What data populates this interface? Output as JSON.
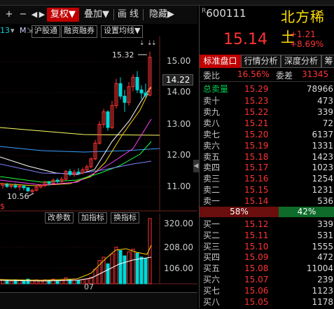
{
  "toolbar": {
    "plus_icon": "+",
    "minus_icon": "−",
    "left_icon": "◀",
    "right_icon": "▶",
    "fuquan": "复权▼",
    "diejia": "叠加▼",
    "huaxian": "画 线",
    "yincang": "隐藏▶"
  },
  "chart_tools": {
    "num": "13",
    "m_label": "M",
    "hgt": "沪股通",
    "rzrq": "融资融券",
    "set_ma": "设置均线▼"
  },
  "chart_labels": {
    "high_price": "15.32",
    "low_price": "10.56",
    "date_label": "07",
    "icon_s": "$"
  },
  "price_axis": [
    "15.00",
    "14.22",
    "14.00",
    "13.00",
    "12.00",
    "11.00"
  ],
  "volume_axis": [
    "320.00",
    "208.00",
    "106.00"
  ],
  "indicator_toolbar": {
    "gai_canshu": "改参数",
    "jia_zhibiao": "加指标",
    "huan_zhibiao": "换指标"
  },
  "stock": {
    "code": "600111",
    "code_prefix": "R",
    "name": "北方稀土",
    "price": "15.14",
    "change": "+1.21",
    "change_pct": "+8.69%"
  },
  "tabs": [
    "标准盘口",
    "行情分析",
    "深度分析",
    "筹"
  ],
  "weibi": {
    "label": "委比",
    "value": "16.56%",
    "label2": "委差",
    "value2": "31345"
  },
  "sell_total": {
    "label": "总卖量",
    "price": "15.29",
    "volume": "78966"
  },
  "sell_orders": [
    {
      "label": "卖十",
      "price": "15.23",
      "volume": "473"
    },
    {
      "label": "卖九",
      "price": "15.22",
      "volume": "339"
    },
    {
      "label": "卖八",
      "price": "15.21",
      "volume": "72"
    },
    {
      "label": "卖七",
      "price": "15.20",
      "volume": "6137"
    },
    {
      "label": "卖六",
      "price": "15.19",
      "volume": "1331"
    },
    {
      "label": "卖五",
      "price": "15.18",
      "volume": "1423"
    },
    {
      "label": "卖四",
      "price": "15.17",
      "volume": "1023"
    },
    {
      "label": "卖三",
      "price": "15.16",
      "volume": "1254"
    },
    {
      "label": "卖二",
      "price": "15.15",
      "volume": "1231"
    },
    {
      "label": "卖一",
      "price": "15.14",
      "volume": "536"
    }
  ],
  "ratio": {
    "sell": "58%",
    "buy": "42%"
  },
  "buy_orders": [
    {
      "label": "买一",
      "price": "15.12",
      "volume": "339"
    },
    {
      "label": "买二",
      "price": "15.11",
      "volume": "531"
    },
    {
      "label": "买三",
      "price": "15.10",
      "volume": "1555"
    },
    {
      "label": "买四",
      "price": "15.09",
      "volume": "472"
    },
    {
      "label": "买五",
      "price": "15.08",
      "volume": "11004"
    },
    {
      "label": "买六",
      "price": "15.07",
      "volume": "239"
    },
    {
      "label": "买七",
      "price": "15.06",
      "volume": "1123"
    },
    {
      "label": "买八",
      "price": "15.05",
      "volume": "1178"
    }
  ],
  "colors": {
    "up": "#ff3333",
    "down": "#00d8d8",
    "accent": "#c00000",
    "name": "#ffde00"
  }
}
